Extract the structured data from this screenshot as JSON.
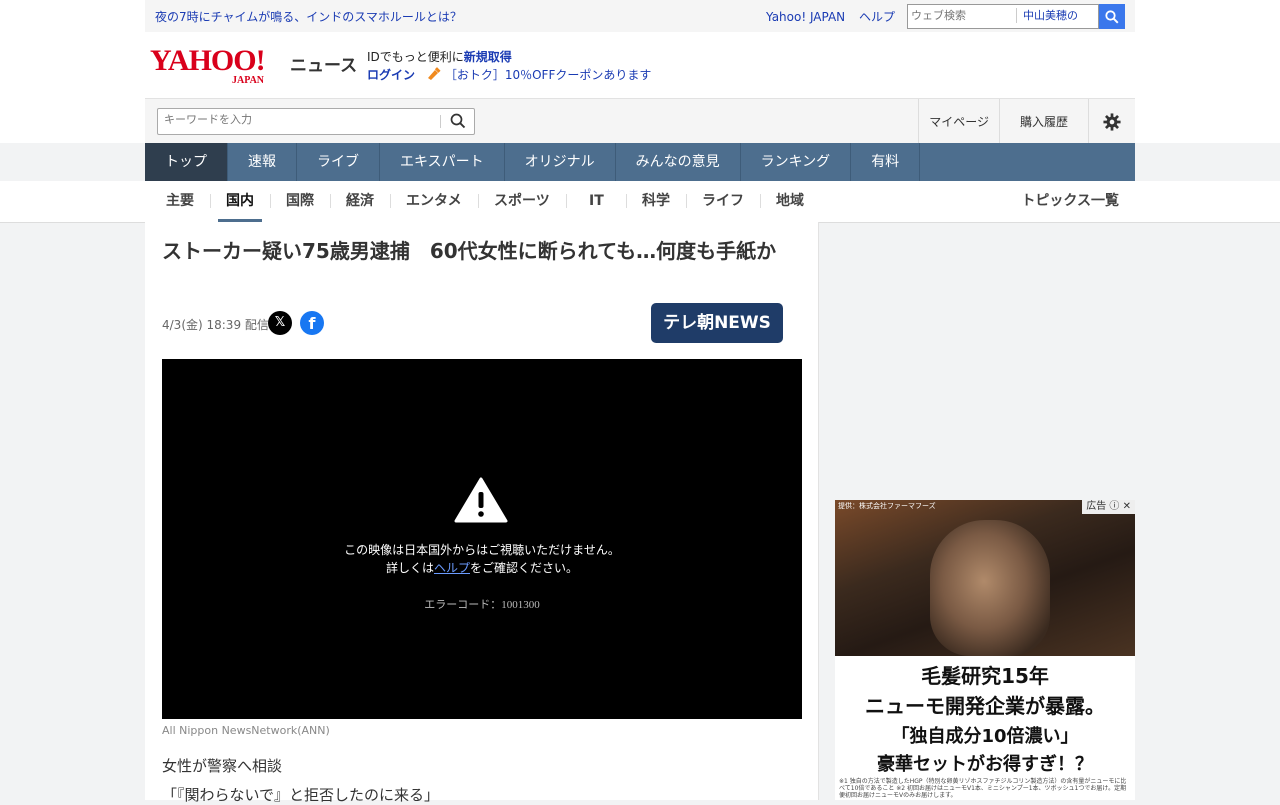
{
  "topbar": {
    "promo": "夜の7時にチャイムが鳴る、インドのスマホルールとは？",
    "links": [
      "Yahoo! JAPAN",
      "ヘルプ"
    ],
    "search_placeholder": "ウェブ検索",
    "search_chip": "中山美穂の"
  },
  "header": {
    "logo_main": "YAHOO!",
    "logo_sub": "JAPAN",
    "logo_news": "ニュース",
    "id_text": "IDでもっと便利に",
    "id_link": "新規取得",
    "login": "ログイン",
    "coupon": "［おトク］10％OFFクーポンあります"
  },
  "search": {
    "placeholder": "キーワードを入力"
  },
  "user_menu": [
    "マイページ",
    "購入履歴"
  ],
  "nav": [
    "トップ",
    "速報",
    "ライブ",
    "エキスパート",
    "オリジナル",
    "みんなの意見",
    "ランキング",
    "有料"
  ],
  "subnav": {
    "tabs": [
      "主要",
      "国内",
      "国際",
      "経済",
      "エンタメ",
      "スポーツ",
      "IT",
      "科学",
      "ライフ",
      "地域"
    ],
    "active": "国内",
    "all_topics": "トピックス一覧"
  },
  "article": {
    "title": "ストーカー疑い75歳男逮捕　60代女性に断られても…何度も手紙か",
    "date": "4/3(金) 18:39 配信",
    "publisher": "テレ朝NEWS",
    "video_msg1": "この映像は日本国外からはご視聴いただけません。",
    "video_msg2_pre": "詳しくは",
    "video_msg2_link": "ヘルプ",
    "video_msg2_post": "をご確認ください。",
    "video_error": "エラーコード：1001300",
    "credit": "All Nippon NewsNetwork(ANN)",
    "body": [
      "女性が警察へ相談",
      "「『関わらないで』と拒否したのに来る」"
    ]
  },
  "ad": {
    "provider": "提供：株式会社ファーマフーズ",
    "label": "広告",
    "line1": "毛髪研究15年",
    "line2": "ニューモ開発企業が暴露。",
    "line3": "「独自成分10倍濃い」",
    "line4": "豪華セットがお得すぎ！？",
    "fine": "※1 独自の方法で製造したHGP（特別な卵黄リゾホスファチジルコリン製造方法）の含有量がニューモに比べて10倍であること ※2 初回お届けはニューモV1本、ミニシャンプー1本、ツボッシュ1つでお届け。定期便初回お届けニューモVのみお届けします。"
  }
}
